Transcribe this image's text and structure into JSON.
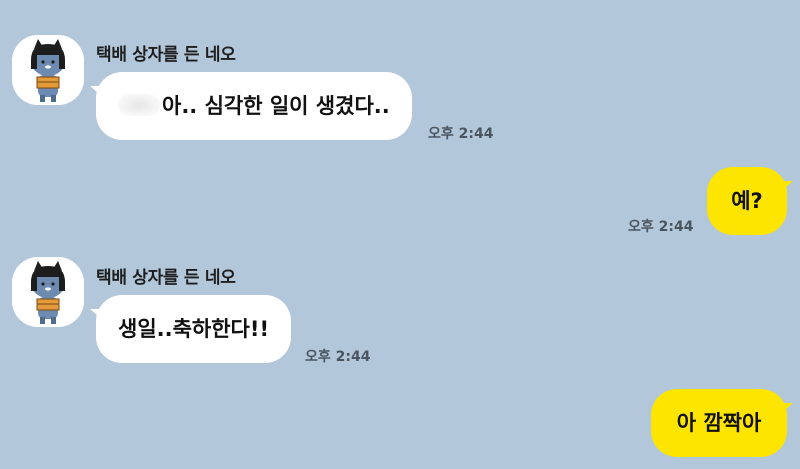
{
  "messages": [
    {
      "sender": "택배 상자를 든 네오",
      "avatar": "neo-cat-holding-box-avatar",
      "text": "아.. 심각한 일이 생겼다..",
      "time": "오후 2:44"
    },
    {
      "text": "예?",
      "time": "오후 2:44"
    },
    {
      "sender": "택배 상자를 든 네오",
      "avatar": "neo-cat-holding-box-avatar",
      "text": "생일..축하한다!!",
      "time": "오후 2:44"
    },
    {
      "text": "아 깜짝아"
    }
  ],
  "colors": {
    "background": "#b2c7d9",
    "incoming_bubble": "#ffffff",
    "outgoing_bubble": "#fee500"
  }
}
